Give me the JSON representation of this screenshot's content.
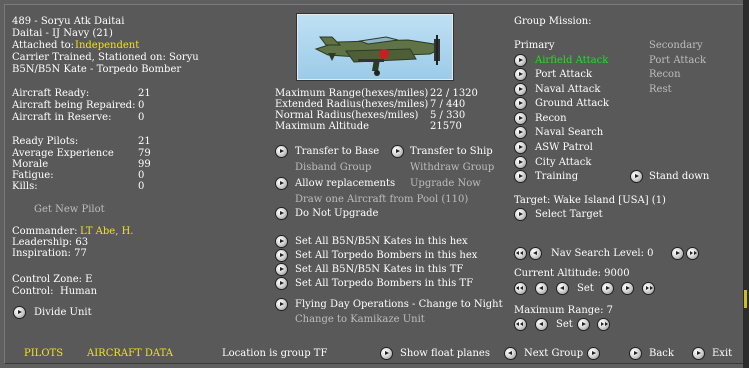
{
  "unit": {
    "title": "489 - Soryu Atk Daitai",
    "subtitle": "Daitai - IJ Navy (21)",
    "attached_label": "Attached to:",
    "attached_value": "Independent",
    "carrier": "Carrier Trained, Stationed on: Soryu",
    "aircraft": "B5N/B5N Kate - Torpedo Bomber"
  },
  "stats": [
    {
      "label": "Aircraft Ready:",
      "value": "21"
    },
    {
      "label": "Aircraft being Repaired:",
      "value": "0"
    },
    {
      "label": "Aircraft in Reserve:",
      "value": "0"
    }
  ],
  "pilots": [
    {
      "label": "Ready Pilots:",
      "value": "21"
    },
    {
      "label": "Average Experience",
      "value": "79"
    },
    {
      "label": "Morale",
      "value": "99"
    },
    {
      "label": "Fatigue:",
      "value": "0"
    },
    {
      "label": "Kills:",
      "value": "0"
    }
  ],
  "get_new_pilot": "Get New Pilot",
  "commander": {
    "label": "Commander:",
    "value": "LT Abe, H."
  },
  "leadership": "Leadership: 63",
  "inspiration": "Inspiration: 77",
  "control_zone": "Control Zone: E",
  "control": {
    "label": "Control:",
    "value": "Human"
  },
  "divide_unit": "Divide Unit",
  "range": [
    {
      "label": "Maximum Range(hexes/miles)",
      "value": "22 / 1320"
    },
    {
      "label": "Extended Radius(hexes/miles)",
      "value": "7 / 440"
    },
    {
      "label": "Normal Radius(hexes/miles)",
      "value": "5 / 330"
    },
    {
      "label": "Maximum Altitude",
      "value": "21570"
    }
  ],
  "actions": {
    "transfer_base": "Transfer to Base",
    "transfer_ship": "Transfer to Ship",
    "disband": "Disband Group",
    "withdraw": "Withdraw Group",
    "allow_replacements": "Allow replacements",
    "upgrade_now": "Upgrade Now",
    "draw_one": "Draw one Aircraft from Pool (110)",
    "do_not_upgrade": "Do Not Upgrade",
    "set_all_1": "Set All B5N/B5N Kates in this hex",
    "set_all_2": "Set All Torpedo Bombers in this hex",
    "set_all_3": "Set All B5N/B5N Kates in this TF",
    "set_all_4": "Set All Torpedo Bombers in this TF",
    "flying_day": "Flying Day Operations - Change to Night",
    "kamikaze": "Change to Kamikaze Unit"
  },
  "mission": {
    "header": "Group Mission:",
    "primary_label": "Primary",
    "secondary_label": "Secondary",
    "primary": [
      "Airfield Attack",
      "Port Attack",
      "Naval Attack",
      "Ground Attack",
      "Recon",
      "Naval Search",
      "ASW Patrol",
      "City Attack",
      "Training"
    ],
    "secondary": [
      "Port Attack",
      "Recon",
      "Rest"
    ],
    "stand_down": "Stand down",
    "target": "Target: Wake Island [USA]  (1)",
    "select_target": "Select Target",
    "nav_search": "Nav Search Level: 0",
    "altitude": "Current Altitude: 9000",
    "set": "Set",
    "max_range": "Maximum Range: 7"
  },
  "bottom": {
    "pilots": "PILOTS",
    "aircraft_data": "AIRCRAFT DATA",
    "location": "Location is group TF",
    "show_float": "Show float planes",
    "next_group": "Next Group",
    "back": "Back",
    "exit": "Exit"
  },
  "colors": {
    "yellow": "#f2e21c",
    "green": "#20e020",
    "panel": "#595959"
  }
}
